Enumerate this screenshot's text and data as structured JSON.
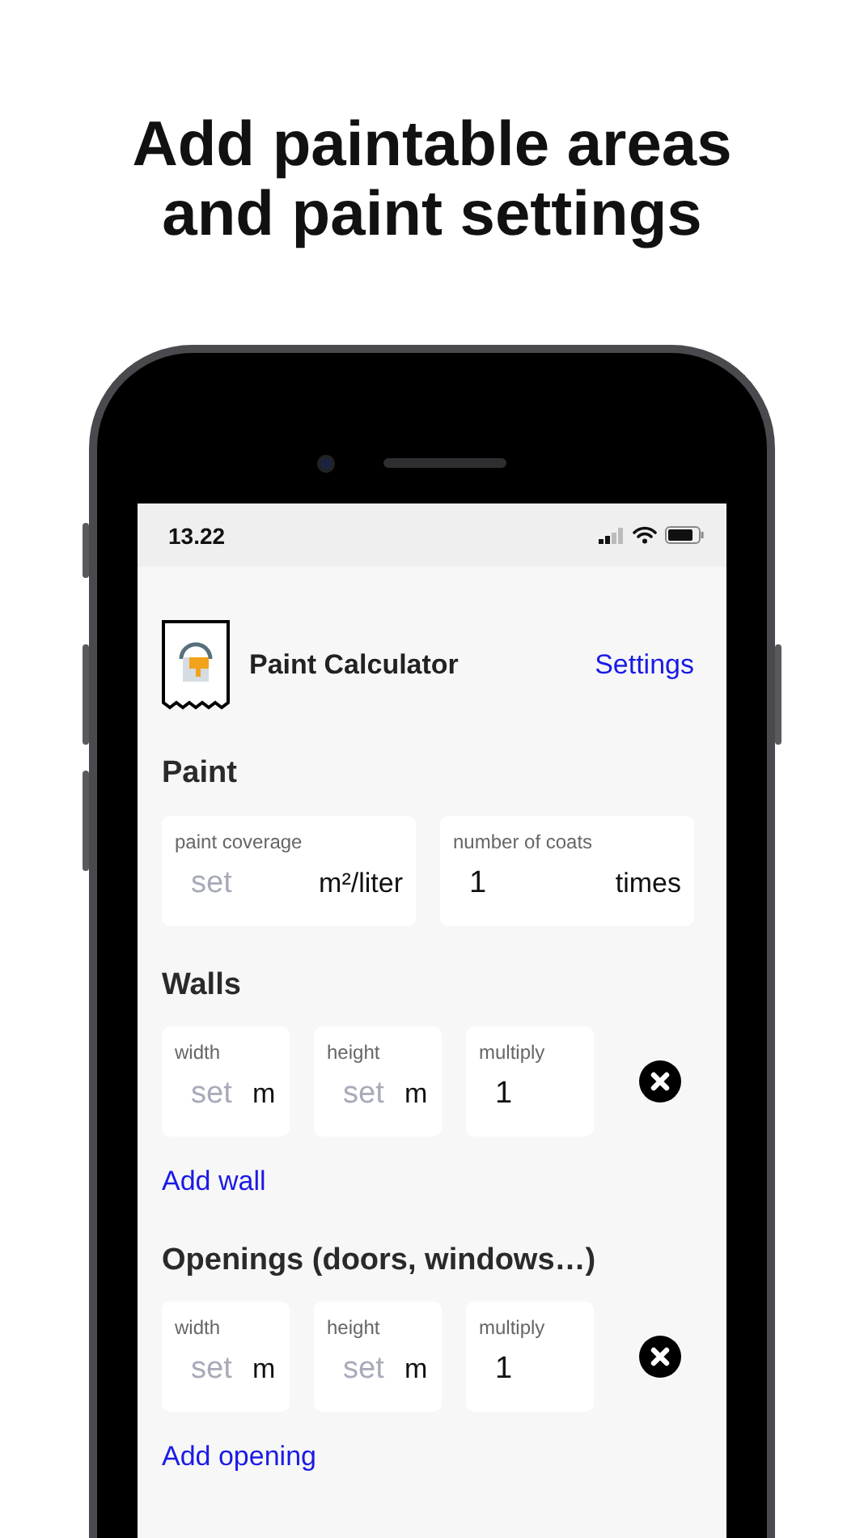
{
  "headline": [
    "Add paintable areas",
    "and paint settings"
  ],
  "status_bar": {
    "time": "13.22"
  },
  "header": {
    "title": "Paint Calculator",
    "settings_link": "Settings"
  },
  "paint": {
    "heading": "Paint",
    "fields": [
      {
        "label": "paint coverage",
        "placeholder": "set",
        "unit": "m²/liter"
      },
      {
        "label": "number of coats",
        "value": "1",
        "unit": "times"
      }
    ]
  },
  "walls": {
    "heading": "Walls",
    "rows": [
      {
        "fields": [
          {
            "label": "width",
            "placeholder": "set",
            "unit": "m"
          },
          {
            "label": "height",
            "placeholder": "set",
            "unit": "m"
          },
          {
            "label": "multiply",
            "value": "1"
          }
        ]
      }
    ],
    "add_link": "Add wall"
  },
  "openings": {
    "heading": "Openings (doors, windows…)",
    "rows": [
      {
        "fields": [
          {
            "label": "width",
            "placeholder": "set",
            "unit": "m"
          },
          {
            "label": "height",
            "placeholder": "set",
            "unit": "m"
          },
          {
            "label": "multiply",
            "value": "1"
          }
        ]
      }
    ],
    "add_link": "Add opening"
  }
}
